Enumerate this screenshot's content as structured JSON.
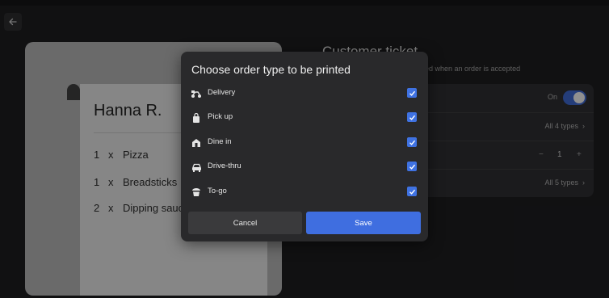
{
  "colors": {
    "accent": "#3f6ee0",
    "background": "#1c1c1e",
    "dialog": "#29292b"
  },
  "statusbar": {
    "text": "…"
  },
  "back_icon": "arrow-left-icon",
  "preview": {
    "customer_name": "Hanna R.",
    "items": [
      {
        "qty": "1",
        "x": "x",
        "name": "Pizza"
      },
      {
        "qty": "1",
        "x": "x",
        "name": "Breadsticks"
      },
      {
        "qty": "2",
        "x": "x",
        "name": "Dipping sauce"
      }
    ]
  },
  "settings": {
    "title": "Customer ticket",
    "description": "plied when an order is accepted",
    "toggle_label": "On",
    "order_types_value": "All 4 types",
    "copies_minus": "−",
    "copies_value": "1",
    "copies_plus": "+",
    "channels_value": "All 5 types"
  },
  "dialog": {
    "title": "Choose order type to be printed",
    "options": [
      {
        "label": "Delivery",
        "icon": "delivery-scooter-icon",
        "checked": true
      },
      {
        "label": "Pick up",
        "icon": "shopping-bag-icon",
        "checked": true
      },
      {
        "label": "Dine in",
        "icon": "store-icon",
        "checked": true
      },
      {
        "label": "Drive-thru",
        "icon": "car-icon",
        "checked": true
      },
      {
        "label": "To-go",
        "icon": "food-container-icon",
        "checked": true
      }
    ],
    "cancel_label": "Cancel",
    "save_label": "Save"
  }
}
